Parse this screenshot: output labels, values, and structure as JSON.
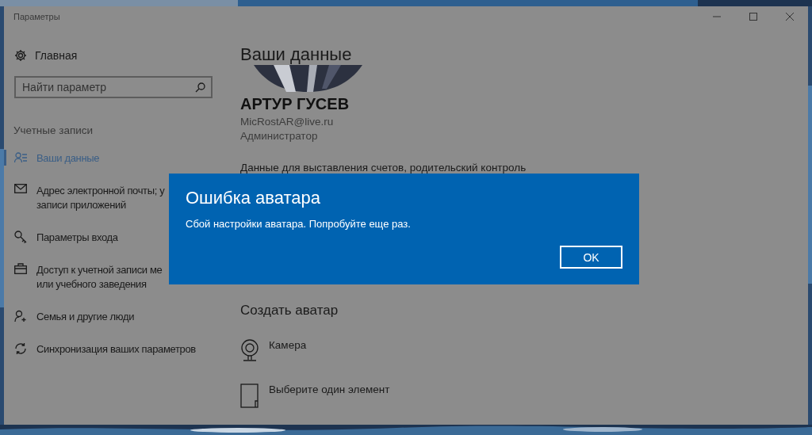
{
  "window": {
    "title": "Параметры"
  },
  "sidebar": {
    "home": "Главная",
    "search": {
      "placeholder": "Найти параметр"
    },
    "section": "Учетные записи",
    "items": [
      {
        "lines": [
          "Ваши данные"
        ],
        "kind": "person-list",
        "selected": true
      },
      {
        "lines": [
          "Адрес электронной почты; у",
          "записи приложений"
        ],
        "kind": "mail",
        "selected": false
      },
      {
        "lines": [
          "Параметры входа"
        ],
        "kind": "key",
        "selected": false
      },
      {
        "lines": [
          "Доступ к учетной записи ме",
          "или учебного заведения"
        ],
        "kind": "briefcase",
        "selected": false
      },
      {
        "lines": [
          "Семья и другие люди"
        ],
        "kind": "person-add",
        "selected": false
      },
      {
        "lines": [
          "Синхронизация ваших параметров"
        ],
        "kind": "sync",
        "selected": false
      }
    ]
  },
  "content": {
    "title": "Ваши данные",
    "user": {
      "name": "АРТУР ГУСЕВ",
      "email": "MicRostAR@live.ru",
      "role": "Администратор"
    },
    "info": "Данные для выставления счетов, родительский контроль",
    "section": "Создать аватар",
    "options": [
      {
        "label": "Камера",
        "kind": "camera"
      },
      {
        "label": "Выберите один элемент",
        "kind": "browse"
      }
    ]
  },
  "dialog": {
    "title": "Ошибка аватара",
    "message": "Сбой настройки аватара. Попробуйте еще раз.",
    "button": "OK"
  }
}
